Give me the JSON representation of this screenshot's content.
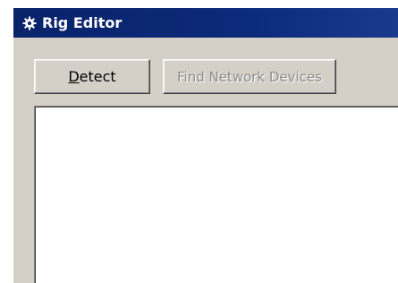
{
  "window": {
    "title": "Rig Editor",
    "icon": "gear-icon"
  },
  "toolbar": {
    "detect_label_first": "D",
    "detect_label_rest": "etect",
    "find_label": "Find Network Devices",
    "find_enabled": false
  },
  "devices_list": {
    "items": []
  },
  "colors": {
    "titlebar": "#0a246a",
    "face": "#d4d0c8",
    "disabled_text": "#8c8c8c"
  }
}
